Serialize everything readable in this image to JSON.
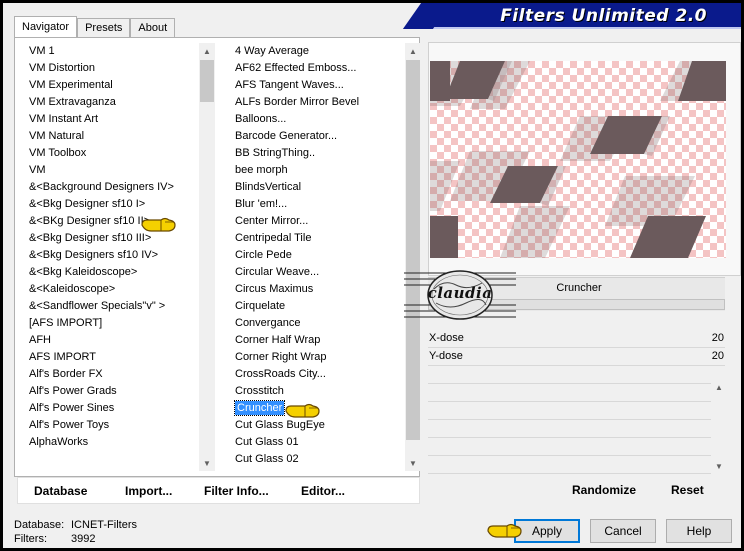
{
  "title": "Filters Unlimited 2.0",
  "tabs": [
    {
      "label": "Navigator",
      "active": true
    },
    {
      "label": "Presets",
      "active": false
    },
    {
      "label": "About",
      "active": false
    }
  ],
  "categories": [
    "VM 1",
    "VM Distortion",
    "VM Experimental",
    "VM Extravaganza",
    "VM Instant Art",
    "VM Natural",
    "VM Toolbox",
    "VM",
    "&<Background Designers IV>",
    "&<Bkg Designer sf10 I>",
    "&<BKg Designer sf10 II>",
    "&<Bkg Designer sf10 III>",
    "&<Bkg Designers sf10 IV>",
    "&<Bkg Kaleidoscope>",
    "&<Kaleidoscope>",
    "&<Sandflower Specials\"v\" >",
    "[AFS IMPORT]",
    "AFH",
    "AFS IMPORT",
    "Alf's Border FX",
    "Alf's Power Grads",
    "Alf's Power Sines",
    "Alf's Power Toys",
    "AlphaWorks"
  ],
  "filters": [
    "4 Way Average",
    "AF62 Effected Emboss...",
    "AFS Tangent Waves...",
    "ALFs Border Mirror Bevel",
    "Balloons...",
    "Barcode Generator...",
    "BB StringThing..",
    "bee morph",
    "BlindsVertical",
    "Blur 'em!...",
    "Center Mirror...",
    "Centripedal Tile",
    "Circle Pede",
    "Circular Weave...",
    "Circus Maximus",
    "Cirquelate",
    "Convergance",
    "Corner Half Wrap",
    "Corner Right Wrap",
    "CrossRoads City...",
    "Crosstitch",
    "Cruncher",
    "Cut Glass  BugEye",
    "Cut Glass 01",
    "Cut Glass 02"
  ],
  "selected_filter_index": 21,
  "filter_name": "Cruncher",
  "params": [
    {
      "label": "X-dose",
      "value": "20"
    },
    {
      "label": "Y-dose",
      "value": "20"
    }
  ],
  "toolbar_left": {
    "database": "Database",
    "import": "Import...",
    "filter_info": "Filter Info...",
    "editor": "Editor..."
  },
  "toolbar_right": {
    "randomize": "Randomize",
    "reset": "Reset"
  },
  "footer": {
    "database_label": "Database:",
    "database_value": "ICNET-Filters",
    "filters_label": "Filters:",
    "filters_value": "3992"
  },
  "buttons": {
    "apply": "Apply",
    "cancel": "Cancel",
    "help": "Help"
  },
  "watermark_text": "claudia",
  "colors": {
    "title_bar": "#0a1a8c",
    "selection": "#3390ff",
    "tile_shape": "#6b5a5c",
    "checker": "#f4c4c4"
  }
}
